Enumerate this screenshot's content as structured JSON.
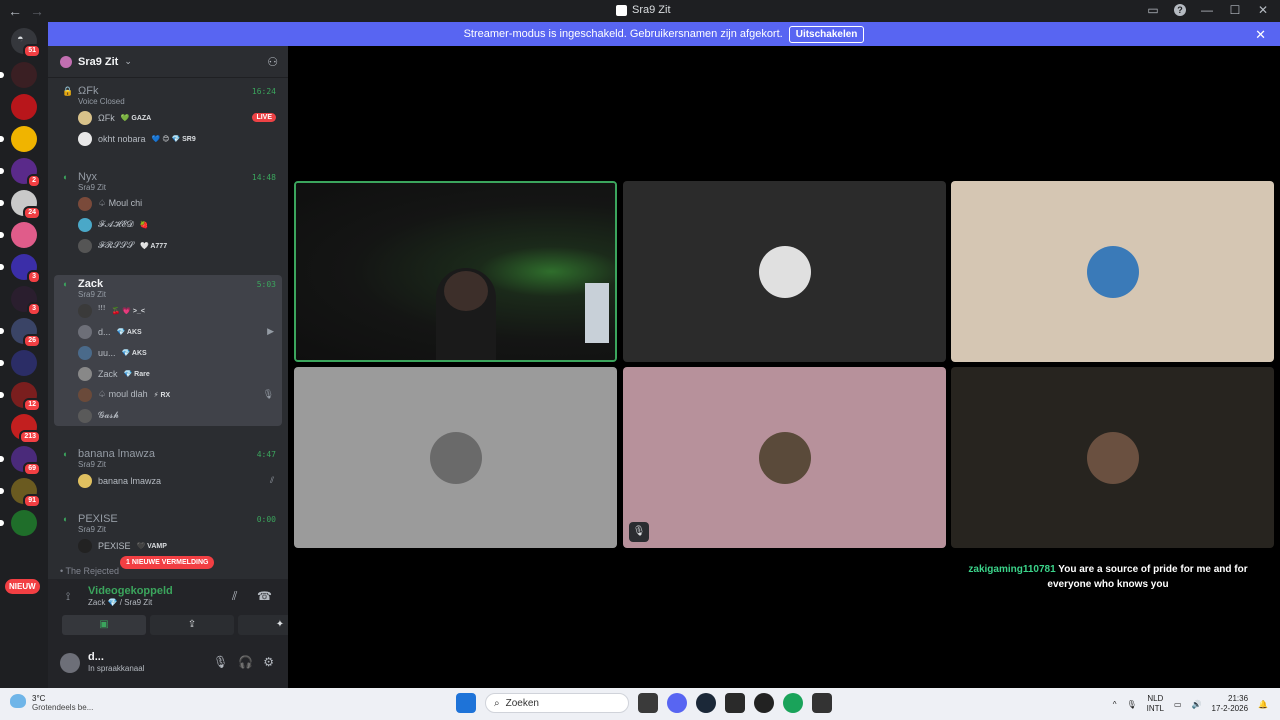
{
  "window": {
    "title": "Sra9 Zit"
  },
  "banner": {
    "text": "Streamer-modus is ingeschakeld. Gebruikersnamen zijn afgekort.",
    "button": "Uitschakelen"
  },
  "guilds": {
    "home_badge": "51",
    "items": [
      {
        "color": "#3a1f23",
        "badge": "",
        "pip": true
      },
      {
        "color": "#b8161b",
        "badge": "",
        "pip": false
      },
      {
        "color": "#f0b400",
        "badge": "",
        "pip": true
      },
      {
        "color": "#5a2a8a",
        "badge": "2",
        "pip": true
      },
      {
        "color": "#c9c9c9",
        "badge": "24",
        "pip": true
      },
      {
        "color": "#e05c8a",
        "badge": "",
        "pip": true
      },
      {
        "color": "#3b2ea8",
        "badge": "3",
        "pip": true
      },
      {
        "color": "#2a1e2e",
        "badge": "3",
        "pip": false
      },
      {
        "color": "#3a4466",
        "badge": "26",
        "pip": true
      },
      {
        "color": "#2b2d66",
        "badge": "",
        "pip": true
      },
      {
        "color": "#7a1e1e",
        "badge": "12",
        "pip": true
      },
      {
        "color": "#c21f1f",
        "badge": "213",
        "pip": false
      },
      {
        "color": "#4a2a7a",
        "badge": "69",
        "pip": true
      },
      {
        "color": "#6a5a20",
        "badge": "91",
        "pip": true
      },
      {
        "color": "#1f6e2a",
        "badge": "",
        "pip": true
      }
    ],
    "nieuw": "NIEUW"
  },
  "server": {
    "name": "Sra9 Zit"
  },
  "channels": [
    {
      "name": "ΩFk",
      "time": "16:24",
      "status": "Voice Closed",
      "locked": true,
      "users": [
        {
          "name": "ΩFk",
          "tag": "💚 GAZA",
          "live": "LIVE",
          "color": "#d9c28a"
        },
        {
          "name": "okht nobara",
          "tag": "💙 😊 💎 SR9",
          "color": "#e8e8e8"
        }
      ]
    },
    {
      "name": "Nyx",
      "time": "14:48",
      "status": "Sra9 Zit",
      "users": [
        {
          "name": "♤ Moul chi",
          "tag": "",
          "color": "#7a4a3a"
        },
        {
          "name": "𝓕𝓐𝓗𝓔𝓓",
          "tag": "🍓",
          "color": "#4aa8c8"
        },
        {
          "name": "𝓕𝓡𝓢𝓢𝓢",
          "tag": "🤍 A777",
          "color": "#555555"
        }
      ]
    },
    {
      "name": "Zack",
      "time": "5:03",
      "status": "Sra9 Zit",
      "active": true,
      "users": [
        {
          "name": "ꜝꜝꜝ",
          "tag": "🍒 💗 >_<",
          "color": "#3a3a3a"
        },
        {
          "name": "d...",
          "tag": "💎 AKS",
          "color": "#6d6f78",
          "icon": "camera"
        },
        {
          "name": "uu...",
          "tag": "💎 AKS",
          "color": "#4a6a8a"
        },
        {
          "name": "Zack",
          "tag": "💎 Rare",
          "color": "#888888"
        },
        {
          "name": "♤ moul dlah",
          "tag": "⚡ RX",
          "color": "#6a4a3a",
          "icon": "mic-off"
        },
        {
          "name": "𝓖𝓪𝓼𝓱",
          "tag": "",
          "color": "#5a5a5a"
        }
      ]
    },
    {
      "name": "banana lmawza",
      "time": "4:47",
      "status": "Sra9 Zit",
      "users": [
        {
          "name": "banana lmawza",
          "tag": "",
          "color": "#e0c060",
          "icon": "deafened"
        }
      ]
    },
    {
      "name": "PEXISE",
      "time": "0:00",
      "status": "Sra9 Zit",
      "users": [
        {
          "name": "PEXISE",
          "tag": "🖤 VAMP",
          "color": "#222222"
        }
      ]
    }
  ],
  "mention_pill": "1 NIEUWE VERMELDING",
  "rejected": "• The Rejected",
  "voice": {
    "status": "Videogekoppeld",
    "location": "Zack 💎 / Sra9 Zit"
  },
  "voice_buttons": {
    "camera": "▣",
    "share": "⇪",
    "activity": "✦"
  },
  "self": {
    "name": "d...",
    "status": "In spraakkanaal"
  },
  "tiles": [
    {
      "type": "video"
    },
    {
      "type": "avatar",
      "bg": "#2b2b2b",
      "av": "#e0e0e0"
    },
    {
      "type": "avatar",
      "bg": "#d5c6b3",
      "av": "#3a7ab8"
    },
    {
      "type": "avatar",
      "bg": "#9b9b9b",
      "av": "#6a6a6a"
    },
    {
      "type": "avatar",
      "bg": "#b7919b",
      "av": "#5a4a3a"
    },
    {
      "type": "avatar",
      "bg": "#27241f",
      "av": "#6a5040"
    }
  ],
  "caption": {
    "user": "zakigaming110781",
    "text": "You are a source of pride for me and for everyone who knows you"
  },
  "taskbar": {
    "temp": "3°C",
    "weather": "Grotendeels be...",
    "search": "Zoeken",
    "lang1": "NLD",
    "lang2": "INTL",
    "time": "21:36",
    "date": "17-2-2026"
  }
}
